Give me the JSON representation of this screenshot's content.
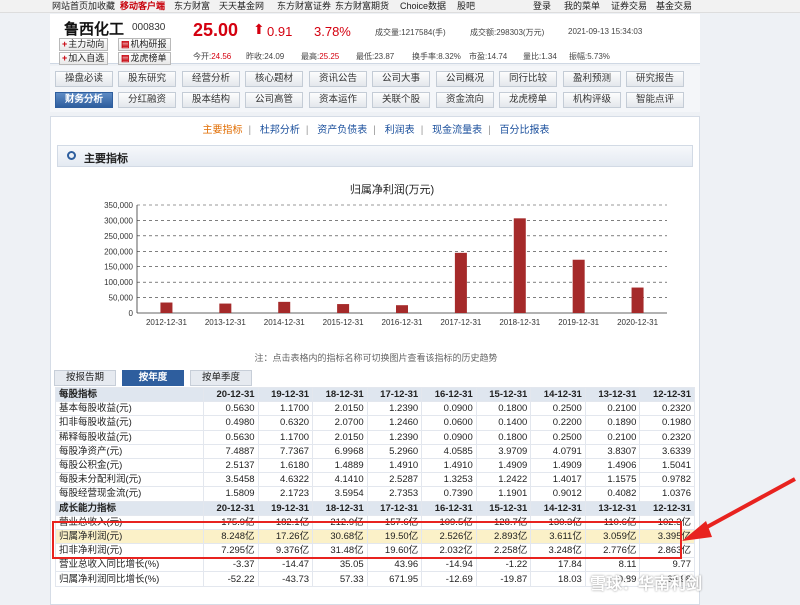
{
  "topbar": {
    "items": [
      "网站首页",
      "加收藏",
      "移动客户端",
      "东方财富",
      "天天基金网",
      "东方财富证券",
      "东方财富期货",
      "Choice数据",
      "股吧"
    ],
    "right": [
      "登录",
      "我的菜单",
      "证券交易",
      "基金交易"
    ]
  },
  "stock": {
    "name": "鲁西化工",
    "code": "000830",
    "price": "25.00",
    "change": "0.91",
    "pct": "3.78%",
    "buttons": [
      "主力动向",
      "机构研报",
      "加入自选",
      "龙虎榜单"
    ]
  },
  "quote": {
    "vol_label": "成交量:",
    "vol": "1217584(手)",
    "amt_label": "成交额:",
    "amt": "298303(万元)",
    "time": "2021-09-13 15:34:03",
    "open_label": "今开:",
    "open": "24.56",
    "prev_label": "昨收:",
    "prev": "24.09",
    "high_label": "最高:",
    "high": "25.25",
    "low_label": "最低:",
    "low": "23.87",
    "turn_label": "换手率:",
    "turn": "8.32%",
    "pe_label": "市盈:",
    "pe": "14.74",
    "qr_label": "量比:",
    "qr": "1.34",
    "amp_label": "振幅:",
    "amp": "5.73%"
  },
  "tabs_row1": [
    "操盘必读",
    "股东研究",
    "经营分析",
    "核心题材",
    "资讯公告",
    "公司大事",
    "公司概况",
    "同行比较",
    "盈利预测",
    "研究报告"
  ],
  "tabs_row2": [
    "财务分析",
    "分红融资",
    "股本结构",
    "公司高管",
    "资本运作",
    "关联个股",
    "资金流向",
    "龙虎榜单",
    "机构评级",
    "智能点评"
  ],
  "subnav": {
    "items": [
      "主要指标",
      "杜邦分析",
      "资产负债表",
      "利润表",
      "现金流量表",
      "百分比报表"
    ],
    "sep": "|"
  },
  "section_title": "主要指标",
  "chart_data": {
    "type": "bar",
    "title": "归属净利润(万元)",
    "categories": [
      "2012-12-31",
      "2013-12-31",
      "2014-12-31",
      "2015-12-31",
      "2016-12-31",
      "2017-12-31",
      "2018-12-31",
      "2019-12-31",
      "2020-12-31"
    ],
    "values": [
      33950,
      30590,
      36110,
      28930,
      25260,
      195000,
      306800,
      172600,
      82480
    ],
    "ylim": [
      0,
      350000
    ],
    "yticks": [
      "0",
      "50,000",
      "100,000",
      "150,000",
      "200,000",
      "250,000",
      "300,000",
      "350,000"
    ],
    "bar_color": "#a52a2a",
    "grid": true
  },
  "note": "注：点击表格内的指标名称可切换图片查看该指标的历史趋势",
  "bottom_tabs": [
    "按报告期",
    "按年度",
    "按单季度"
  ],
  "table": [
    {
      "label": "每股指标",
      "vals": [
        "20-12-31",
        "19-12-31",
        "18-12-31",
        "17-12-31",
        "16-12-31",
        "15-12-31",
        "14-12-31",
        "13-12-31",
        "12-12-31"
      ],
      "type": "group"
    },
    {
      "label": "基本每股收益(元)",
      "vals": [
        "0.5630",
        "1.1700",
        "2.0150",
        "1.2390",
        "0.0900",
        "0.1800",
        "0.2500",
        "0.2100",
        "0.2320"
      ]
    },
    {
      "label": "扣非每股收益(元)",
      "vals": [
        "0.4980",
        "0.6320",
        "2.0700",
        "1.2460",
        "0.0600",
        "0.1400",
        "0.2200",
        "0.1890",
        "0.1980"
      ]
    },
    {
      "label": "稀释每股收益(元)",
      "vals": [
        "0.5630",
        "1.1700",
        "2.0150",
        "1.2390",
        "0.0900",
        "0.1800",
        "0.2500",
        "0.2100",
        "0.2320"
      ]
    },
    {
      "label": "每股净资产(元)",
      "vals": [
        "7.4887",
        "7.7367",
        "6.9968",
        "5.2960",
        "4.0585",
        "3.9709",
        "4.0791",
        "3.8307",
        "3.6339"
      ]
    },
    {
      "label": "每股公积金(元)",
      "vals": [
        "2.5137",
        "1.6180",
        "1.4889",
        "1.4910",
        "1.4910",
        "1.4909",
        "1.4909",
        "1.4906",
        "1.5041"
      ]
    },
    {
      "label": "每股未分配利润(元)",
      "vals": [
        "3.5458",
        "4.6322",
        "4.1410",
        "2.5287",
        "1.3253",
        "1.2422",
        "1.4017",
        "1.1575",
        "0.9782"
      ]
    },
    {
      "label": "每股经营现金流(元)",
      "vals": [
        "1.5809",
        "2.1723",
        "3.5954",
        "2.7353",
        "0.7390",
        "1.1901",
        "0.9012",
        "0.4082",
        "1.0376"
      ]
    },
    {
      "label": "成长能力指标",
      "vals": [
        "20-12-31",
        "19-12-31",
        "18-12-31",
        "17-12-31",
        "16-12-31",
        "15-12-31",
        "14-12-31",
        "13-12-31",
        "12-12-31"
      ],
      "type": "group"
    },
    {
      "label": "营业总收入(元)",
      "vals": [
        "175.9亿",
        "182.1亿",
        "212.9亿",
        "157.6亿",
        "109.5亿",
        "128.7亿",
        "130.3亿",
        "110.6亿",
        "102.3亿"
      ]
    },
    {
      "label": "归属净利润(元)",
      "vals": [
        "8.248亿",
        "17.26亿",
        "30.68亿",
        "19.50亿",
        "2.526亿",
        "2.893亿",
        "3.611亿",
        "3.059亿",
        "3.395亿"
      ],
      "type": "hl"
    },
    {
      "label": "扣非净利润(元)",
      "vals": [
        "7.295亿",
        "9.376亿",
        "31.48亿",
        "19.60亿",
        "2.032亿",
        "2.258亿",
        "3.248亿",
        "2.776亿",
        "2.863亿"
      ]
    },
    {
      "label": "营业总收入同比增长(%)",
      "vals": [
        "-3.37",
        "-14.47",
        "35.05",
        "43.96",
        "-14.94",
        "-1.22",
        "17.84",
        "8.11",
        "9.77"
      ]
    },
    {
      "label": "归属净利润同比增长(%)",
      "vals": [
        "-52.22",
        "-43.73",
        "57.33",
        "671.95",
        "-12.69",
        "-19.87",
        "18.03",
        "-9.89",
        "38.98"
      ]
    }
  ],
  "watermark": "雪球：华南利剑"
}
